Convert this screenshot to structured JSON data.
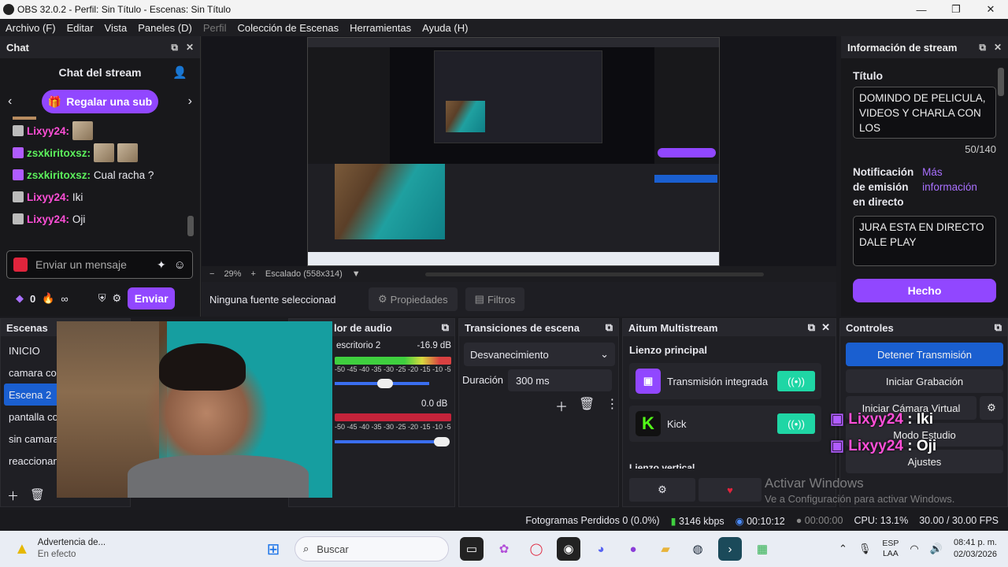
{
  "titlebar": {
    "title": "OBS 32.0.2 - Perfil: Sin Título - Escenas: Sin Título"
  },
  "menu": {
    "items": [
      "Archivo (F)",
      "Editar",
      "Vista",
      "Paneles (D)",
      "Perfil",
      "Colección de Escenas",
      "Herramientas",
      "Ayuda (H)"
    ]
  },
  "chat": {
    "dock_title": "Chat",
    "header": "Chat del stream",
    "gift_label": "Regalar una sub",
    "messages": [
      {
        "user": "Lixyy24:",
        "text": "",
        "thumbs": 1
      },
      {
        "user": "zsxkiritoxsz:",
        "text": "",
        "thumbs": 2
      },
      {
        "user": "zsxkiritoxsz:",
        "text": "Cual racha ?",
        "thumbs": 0
      },
      {
        "user": "Lixyy24:",
        "text": "Iki",
        "thumbs": 0
      },
      {
        "user": "Lixyy24:",
        "text": "Oji",
        "thumbs": 0
      }
    ],
    "input_placeholder": "Enviar un mensaje",
    "points": "0",
    "streak": "∞",
    "send_label": "Enviar"
  },
  "preview": {
    "zoom": "29%",
    "scale": "Escalado (558x314)"
  },
  "sources": {
    "none_selected": "Ninguna fuente seleccionad",
    "properties": "Propiedades",
    "filters": "Filtros"
  },
  "stream_info": {
    "dock_title": "Información de stream",
    "title_label": "Título",
    "title_value": "DOMINDO DE PELICULA, VIDEOS Y CHARLA CON LOS",
    "title_count": "50/140",
    "notif_label": "Notificación de emisión en directo",
    "notif_more": "Más información",
    "notif_value": "JURA ESTA EN DIRECTO DALE PLAY",
    "done": "Hecho"
  },
  "scenes": {
    "title": "Escenas",
    "items": [
      "INICIO",
      "camara cor",
      "Escena 2",
      "pantalla co",
      "sin camara",
      "reaccionan"
    ],
    "selected": 2
  },
  "audio": {
    "title": "lor de audio",
    "ch1_name": "escritorio 2",
    "ch1_db": "-16.9 dB",
    "ch2_db": "0.0 dB",
    "scale": "-50 -45 -40 -35 -30 -25 -20 -15 -10 -5 0"
  },
  "transitions": {
    "title": "Transiciones de escena",
    "type": "Desvanecimiento",
    "duration_label": "Duración",
    "duration_value": "300 ms"
  },
  "multistream": {
    "title": "Aitum Multistream",
    "canvas_label": "Lienzo principal",
    "targets": [
      {
        "name": "Transmisión integrada"
      },
      {
        "name": "Kick"
      }
    ],
    "vertical_label": "Lienzo vertical"
  },
  "controls": {
    "title": "Controles",
    "stop_stream": "Detener Transmisión",
    "start_rec": "Iniciar Grabación",
    "virtual_cam": "Iniciar Cámara Virtual",
    "studio": "Modo Estudio",
    "settings": "Ajustes"
  },
  "overlay": {
    "line1_user": "Lixyy24",
    "line1_text": ": Iki",
    "line2_user": "Lixyy24",
    "line2_text": ": Oji"
  },
  "watermark": {
    "line1": "Activar Windows",
    "line2": "Ve a Configuración para activar Windows."
  },
  "status": {
    "dropped": "Fotogramas Perdidos 0 (0.0%)",
    "bitrate": "3146 kbps",
    "stream_time": "00:10:12",
    "rec_time": "00:00:00",
    "cpu": "CPU: 13.1%",
    "fps": "30.00 / 30.00 FPS"
  },
  "taskbar": {
    "warning_title": "Advertencia de...",
    "warning_sub": "En efecto",
    "search": "Buscar",
    "lang1": "ESP",
    "lang2": "LAA",
    "time": "08:41 p. m.",
    "date": "02/03/2026"
  },
  "colors": {
    "accent": "#9147ff",
    "twitch": "#9147ff",
    "kick": "#53fc18",
    "live": "#1fd6a5",
    "pink": "#ff4fd8",
    "green": "#5cf05c"
  }
}
